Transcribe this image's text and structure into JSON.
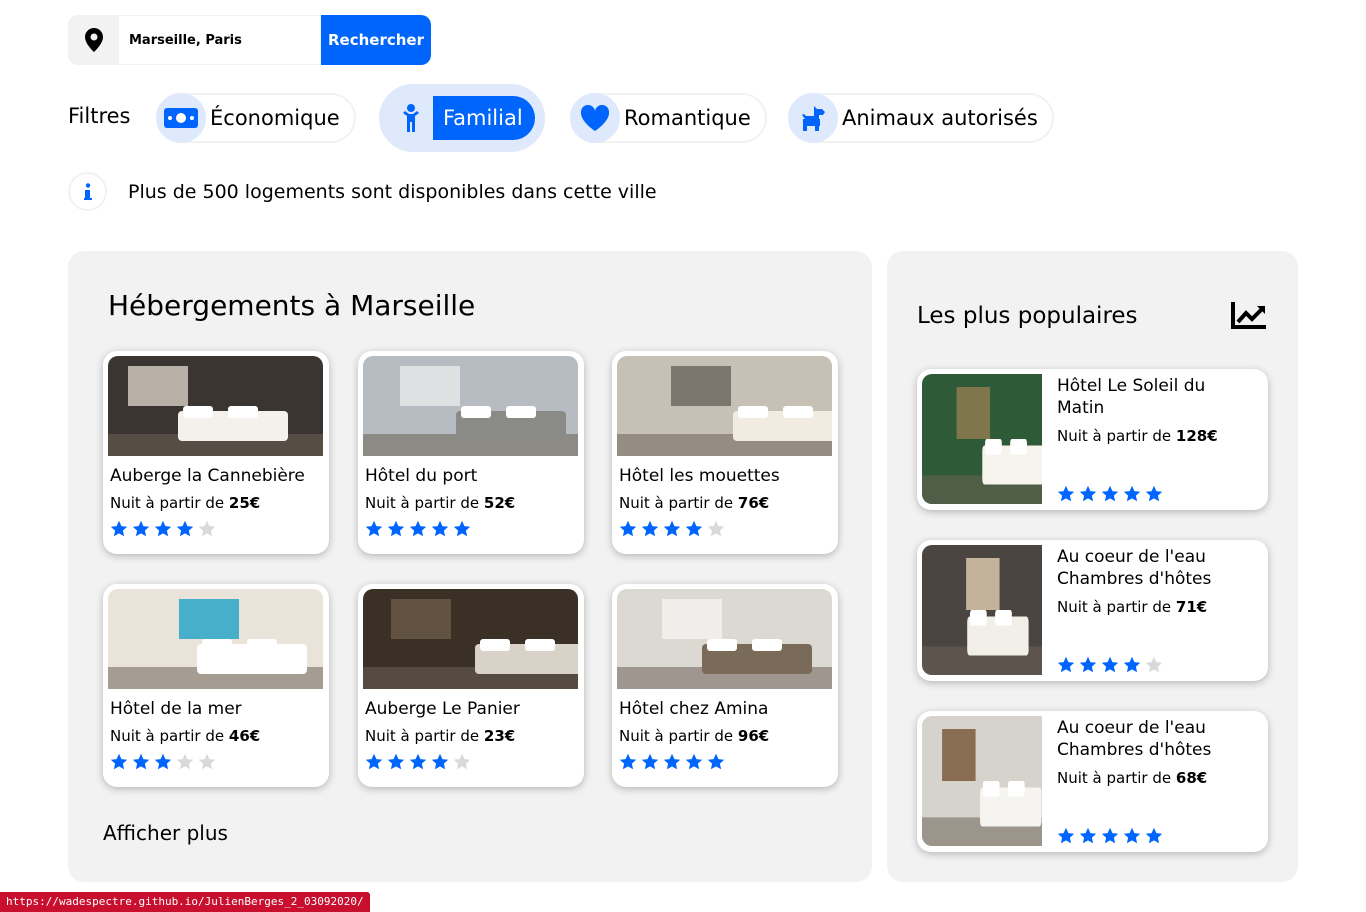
{
  "search": {
    "value": "Marseille, Paris",
    "button": "Rechercher"
  },
  "filters": {
    "label": "Filtres",
    "items": [
      {
        "label": "Économique",
        "icon": "money-icon",
        "active": false
      },
      {
        "label": "Familial",
        "icon": "child-icon",
        "active": true
      },
      {
        "label": "Romantique",
        "icon": "heart-icon",
        "active": false
      },
      {
        "label": "Animaux autorisés",
        "icon": "dog-icon",
        "active": false
      }
    ]
  },
  "info": {
    "text": "Plus de 500 logements sont disponibles dans cette ville"
  },
  "main": {
    "title": "Hébergements à Marseille",
    "price_prefix": "Nuit à partir de",
    "cards": [
      {
        "name": "Auberge la Cannebière",
        "price": "25€",
        "rating": 4
      },
      {
        "name": "Hôtel du port",
        "price": "52€",
        "rating": 5
      },
      {
        "name": "Hôtel les mouettes",
        "price": "76€",
        "rating": 4
      },
      {
        "name": "Hôtel de la mer",
        "price": "46€",
        "rating": 3
      },
      {
        "name": "Auberge Le Panier",
        "price": "23€",
        "rating": 4
      },
      {
        "name": "Hôtel chez Amina",
        "price": "96€",
        "rating": 5
      }
    ],
    "more": "Afficher plus"
  },
  "popular": {
    "title": "Les plus populaires",
    "items": [
      {
        "name": "Hôtel Le Soleil du Matin",
        "price": "128€",
        "rating": 5
      },
      {
        "name": "Au coeur de l'eau Chambres d'hôtes",
        "price": "71€",
        "rating": 4
      },
      {
        "name": "Au coeur de l'eau Chambres d'hôtes",
        "price": "68€",
        "rating": 5
      }
    ]
  },
  "status_url": "https://wadespectre.github.io/JulienBerges_2_03092020/",
  "colors": {
    "accent": "#0065fc",
    "accent_light": "#dee9fc",
    "panel": "#f2f2f2",
    "star_off": "#d9d9d9"
  }
}
